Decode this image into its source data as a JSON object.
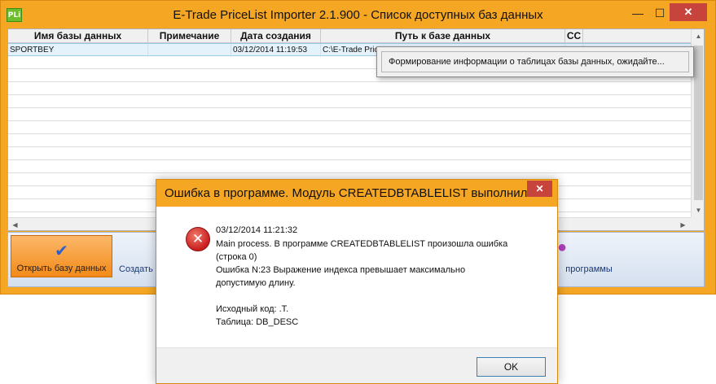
{
  "main_window": {
    "title": "E-Trade PriceList Importer 2.1.900 - Список доступных баз данных",
    "icon_text": "PLi",
    "minimize": "—",
    "maximize": "☐",
    "close": "✕"
  },
  "grid": {
    "columns": [
      "Имя базы данных",
      "Примечание",
      "Дата создания",
      "Путь к базе данных",
      "CC"
    ],
    "rows": [
      {
        "name": "SPORTBEY",
        "note": "",
        "created": "03/12/2014 11:19:53",
        "path": "C:\\E-Trade Pric",
        "cc": ""
      }
    ]
  },
  "toolbar": {
    "buttons": [
      {
        "label": "Открыть базу данных",
        "icon": "check-icon"
      },
      {
        "label": "Создать",
        "icon": ""
      },
      {
        "label": "программы",
        "icon": "settings-icon"
      }
    ]
  },
  "progress_popup": {
    "text": "Формирование информации о таблицах базы данных, ожидайте..."
  },
  "error_dialog": {
    "title": "Ошибка в программе. Модуль CREATEDBTABLELIST выполнил ...",
    "close": "✕",
    "lines": [
      "03/12/2014 11:21:32",
      "Main process. В программе CREATEDBTABLELIST произошла ошибка",
      "(строка 0)",
      "Ошибка N:23 Выражение индекса превышает максимально",
      "допустимую длину.",
      "",
      "Исходный код: .Т.",
      "Таблица: DB_DESC"
    ],
    "ok_label": "OK"
  }
}
